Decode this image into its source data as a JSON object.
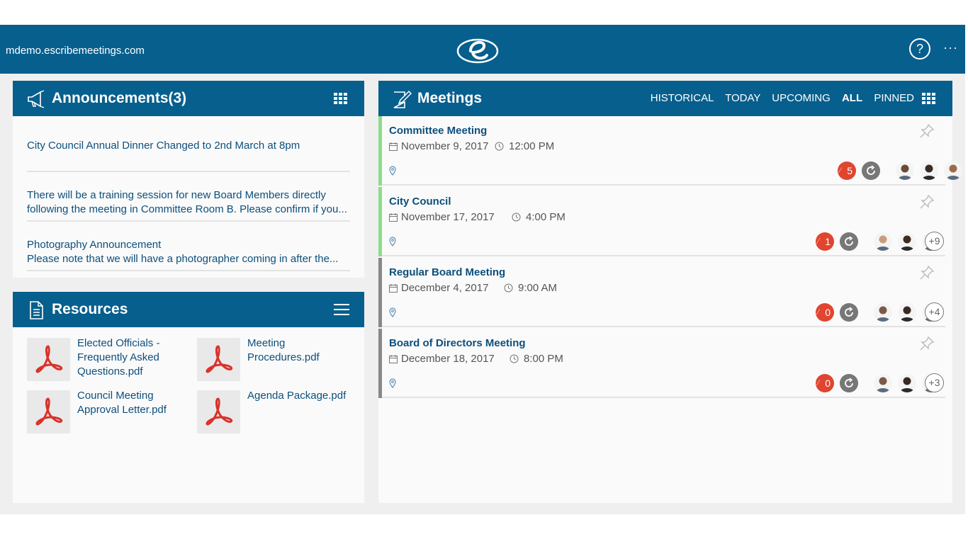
{
  "topbar": {
    "host": "mdemo.escribemeetings.com",
    "help_label": "?",
    "more_label": "···"
  },
  "announcements": {
    "title": "Announcements(3)",
    "items": [
      {
        "line1": "City Council Annual Dinner Changed to 2nd March at 8pm",
        "line2": ""
      },
      {
        "line1": "There will be a training session for new Board Members directly",
        "line2": "following the meeting in Committee Room B. Please confirm if you..."
      },
      {
        "line1": "Photography Announcement",
        "line2": "Please note that we will have a photographer coming in after the..."
      }
    ]
  },
  "resources": {
    "title": "Resources",
    "items": [
      {
        "name": "Elected Officials - Frequently Asked Questions.pdf"
      },
      {
        "name": "Meeting Procedures.pdf"
      },
      {
        "name": "Council Meeting Approval Letter.pdf"
      },
      {
        "name": "Agenda Package.pdf"
      }
    ]
  },
  "meetings": {
    "title": "Meetings",
    "tabs": [
      "HISTORICAL",
      "TODAY",
      "UPCOMING",
      "ALL",
      "PINNED"
    ],
    "active_tab": "ALL",
    "items": [
      {
        "title": "Committee Meeting",
        "date": "November 9, 2017",
        "time": "12:00 PM",
        "count": "5",
        "more": "",
        "bar_color": "#8ddc8a"
      },
      {
        "title": "City Council",
        "date": "November 17, 2017",
        "time": "4:00 PM",
        "count": "1",
        "more": "+9",
        "bar_color": "#8ddc8a"
      },
      {
        "title": "Regular Board Meeting",
        "date": "December 4, 2017",
        "time": "9:00 AM",
        "count": "0",
        "more": "+4",
        "bar_color": "#888888"
      },
      {
        "title": "Board of Directors Meeting",
        "date": "December 18, 2017",
        "time": "8:00 PM",
        "count": "0",
        "more": "+3",
        "bar_color": "#888888"
      }
    ]
  },
  "colors": {
    "brand": "#075f8d",
    "link": "#0d4f7c",
    "badge": "#e0452f"
  }
}
